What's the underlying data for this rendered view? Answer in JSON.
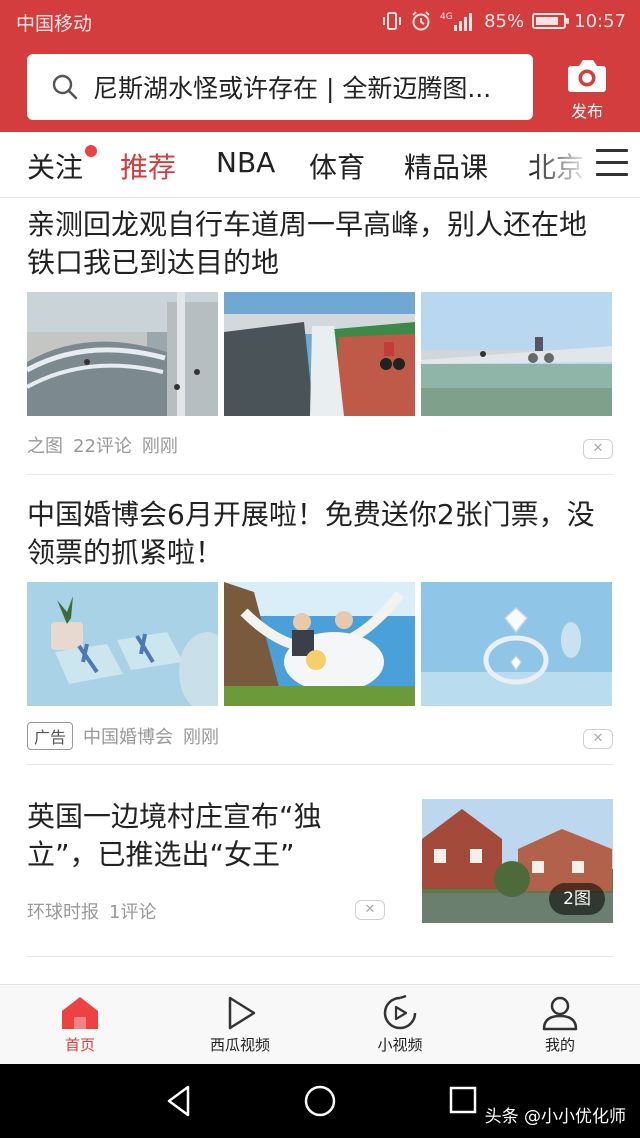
{
  "status_bar": {
    "carrier": "中国移动",
    "network": "4G",
    "battery_percent": "85%",
    "battery_level": 0.85,
    "time": "10:57",
    "icons": [
      "vibrate-icon",
      "alarm-icon",
      "signal-icon",
      "battery-icon"
    ]
  },
  "header": {
    "search_placeholder": "尼斯湖水怪或许存在 | 全新迈腾图...",
    "publish_label": "发布",
    "accent_color": "#d43d3d"
  },
  "tabs": [
    {
      "label": "关注",
      "badge": true
    },
    {
      "label": "推荐",
      "active": true
    },
    {
      "label": "NBA"
    },
    {
      "label": "体育"
    },
    {
      "label": "精品课"
    },
    {
      "label": "北京"
    }
  ],
  "feed": [
    {
      "title": "亲测回龙观自行车道周一早高峰，别人还在地铁口我已到达目的地",
      "source": "之图",
      "comments": "22评论",
      "time": "刚刚"
    },
    {
      "title": "中国婚博会6月开展啦！免费送你2张门票，没领票的抓紧啦！",
      "ad_label": "广告",
      "source": "中国婚博会",
      "time": "刚刚"
    },
    {
      "title": "英国一边境村庄宣布“独立”，已推选出“女王”",
      "source": "环球时报",
      "comments": "1评论",
      "image_count": "2图"
    }
  ],
  "bottom_nav": [
    {
      "label": "首页",
      "icon": "home-icon",
      "active": true
    },
    {
      "label": "西瓜视频",
      "icon": "play-icon"
    },
    {
      "label": "小视频",
      "icon": "short-video-icon"
    },
    {
      "label": "我的",
      "icon": "profile-icon"
    }
  ],
  "watermark": "头条 @小小优化师"
}
